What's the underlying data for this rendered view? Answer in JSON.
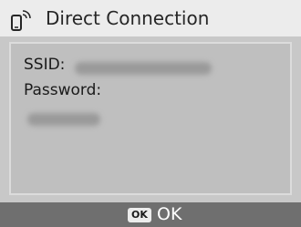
{
  "header": {
    "icon": "smartphone-signal-icon",
    "title": "Direct Connection"
  },
  "details": {
    "ssid_label": "SSID:",
    "password_label": "Password:"
  },
  "footer": {
    "key_label": "OK",
    "action_label": "OK"
  },
  "colors": {
    "background": "#c8c8c8",
    "title_bar": "#ececec",
    "footer_bar": "#6f6f6f"
  }
}
